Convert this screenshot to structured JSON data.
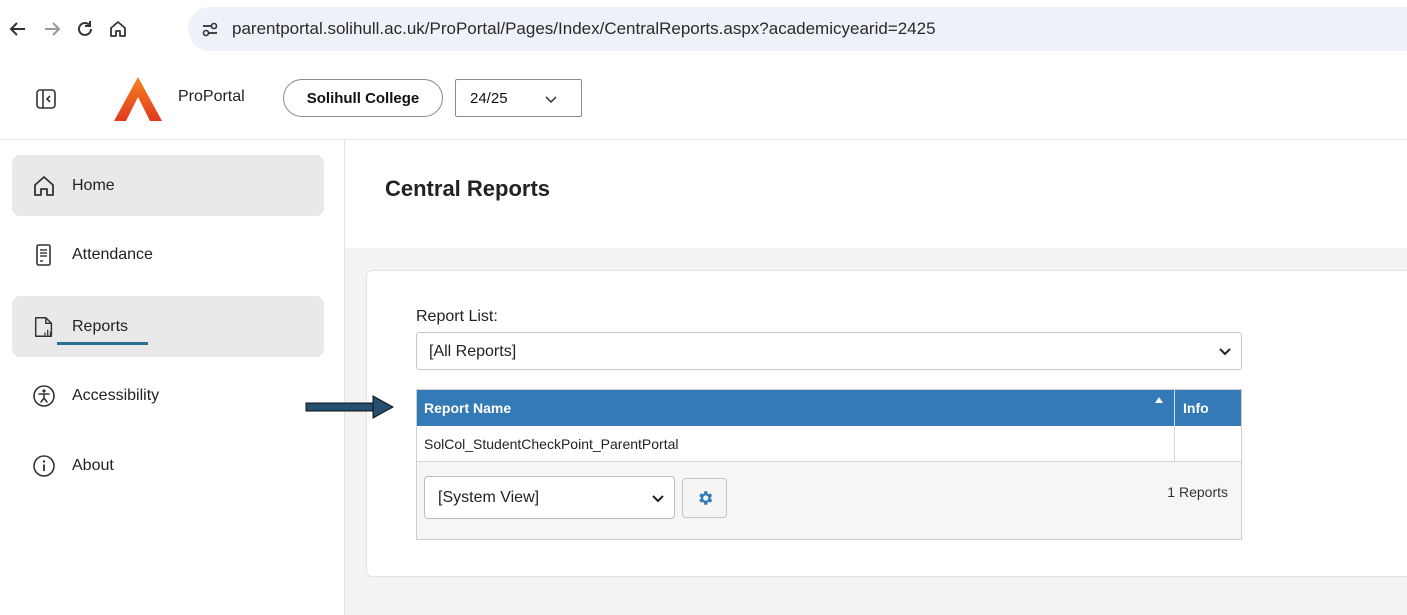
{
  "browser": {
    "url": "parentportal.solihull.ac.uk/ProPortal/Pages/Index/CentralReports.aspx?academicyearid=2425"
  },
  "header": {
    "app_name": "ProPortal",
    "college": "Solihull College",
    "year": "24/25"
  },
  "sidebar": {
    "items": [
      {
        "label": "Home",
        "icon": "home-icon"
      },
      {
        "label": "Attendance",
        "icon": "attendance-icon"
      },
      {
        "label": "Reports",
        "icon": "reports-icon",
        "active": true
      },
      {
        "label": "Accessibility",
        "icon": "accessibility-icon"
      },
      {
        "label": "About",
        "icon": "info-icon"
      }
    ]
  },
  "main": {
    "title": "Central Reports",
    "report_list_label": "Report List:",
    "report_list_value": "[All Reports]",
    "table": {
      "columns": [
        "Report Name",
        "Info"
      ],
      "rows": [
        {
          "name": "SolCol_StudentCheckPoint_ParentPortal",
          "info": ""
        }
      ]
    },
    "view_select": "[System View]",
    "count": "1 Reports"
  },
  "colors": {
    "accent": "#337ab7",
    "active_underline": "#2c6e8f",
    "logo_orange": "#e8541c"
  }
}
